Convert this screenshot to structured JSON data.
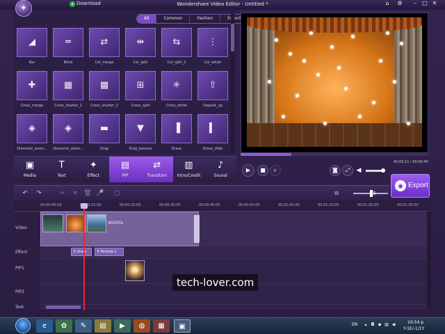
{
  "titlebar": {
    "download_label": "Download",
    "window_title": "Wondershare Video Editor - Untitled *"
  },
  "library": {
    "filter_tabs": [
      {
        "label": "All",
        "active": true
      },
      {
        "label": "Common",
        "active": false
      },
      {
        "label": "Fashion",
        "active": false
      },
      {
        "label": "Favorite",
        "active": false
      }
    ],
    "transitions": [
      {
        "label": "Bar",
        "icon": "diagonal-steps-icon"
      },
      {
        "label": "Blind",
        "icon": "blind-icon"
      },
      {
        "label": "Col_merge",
        "icon": "col-merge-icon"
      },
      {
        "label": "Col_split",
        "icon": "col-split-icon"
      },
      {
        "label": "Col_split_2",
        "icon": "col-split-2-icon"
      },
      {
        "label": "Col_whisk",
        "icon": "col-whisk-icon"
      },
      {
        "label": "Cross_merge",
        "icon": "cross-merge-icon"
      },
      {
        "label": "Cross_shutter_1",
        "icon": "cross-shutter-1-icon"
      },
      {
        "label": "Cross_shutter_2",
        "icon": "cross-shutter-2-icon"
      },
      {
        "label": "Cross_split",
        "icon": "cross-split-icon"
      },
      {
        "label": "Cross_whisk",
        "icon": "cross-whisk-icon"
      },
      {
        "label": "Deposit_up",
        "icon": "deposit-up-icon"
      },
      {
        "label": "Diamond_zoom...",
        "icon": "diamond-zoom-icon"
      },
      {
        "label": "Diamond_zoom...",
        "icon": "diamond-zoom-2-icon"
      },
      {
        "label": "Drap",
        "icon": "drap-icon"
      },
      {
        "label": "Drop_bounce",
        "icon": "drop-bounce-icon"
      },
      {
        "label": "Erase",
        "icon": "erase-icon"
      },
      {
        "label": "Erase_slide",
        "icon": "erase-slide-icon"
      }
    ]
  },
  "categories": [
    {
      "label": "Media",
      "icon": "media-icon",
      "active": false
    },
    {
      "label": "Text",
      "icon": "text-icon",
      "active": false
    },
    {
      "label": "Effect",
      "icon": "effect-icon",
      "active": false
    },
    {
      "label": "PIP",
      "icon": "pip-icon",
      "active": true
    },
    {
      "label": "Transition",
      "icon": "transition-icon",
      "active": true
    },
    {
      "label": "Intro/Credit",
      "icon": "intro-credit-icon",
      "active": false
    },
    {
      "label": "Sound",
      "icon": "sound-icon",
      "active": false
    }
  ],
  "preview": {
    "timecode": "00:00:11 / 00:00:40",
    "progress": 0.27
  },
  "export_label": "Export",
  "timeline": {
    "ruler_ticks": [
      "00:00:00:00",
      "00:00:10:00",
      "00:00:20:00",
      "00:00:30:00",
      "00:00:40:00",
      "00:00:50:00",
      "00:01:00:00",
      "00:01:10:00",
      "00:01:20:00",
      "00:01:30:00"
    ],
    "tracks": [
      "Video",
      "Effect",
      "PIP1",
      "PIP2",
      "Text"
    ],
    "video_clip_name": "Wildlife",
    "effects": [
      "E Snow",
      "E Particle 1"
    ]
  },
  "watermark": "tech-lover.com",
  "taskbar": {
    "lang": "EN",
    "time": "10:54 p",
    "date": "Y-1E/-1/1Y"
  },
  "colors": {
    "accent": "#7b4ec4",
    "playhead": "#e0302a",
    "background": "#2c1f45"
  }
}
